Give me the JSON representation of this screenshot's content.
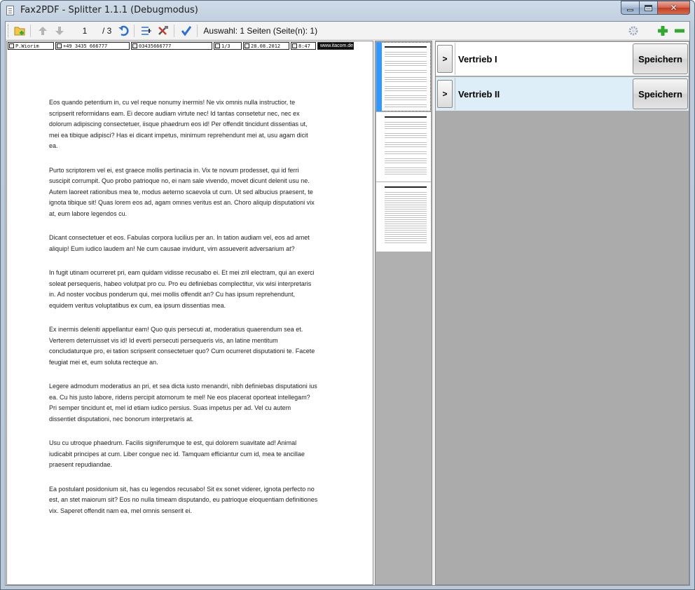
{
  "window": {
    "title": "Fax2PDF - Splitter  1.1.1 (Debugmodus)",
    "caption_close": "✕"
  },
  "toolbar": {
    "current_page": "1",
    "total_pages": "/ 3",
    "selection_text": "Auswahl: 1 Seiten (Seite(n): 1)",
    "icons": [
      "open-folder-icon",
      "arrow-up-icon",
      "arrow-down-icon",
      "undo-icon",
      "split-icon",
      "tools-icon",
      "check-arrow-icon",
      "settings-gear-icon",
      "add-icon",
      "remove-icon"
    ]
  },
  "fax_header": {
    "sender": "P.Wiorim",
    "phone": "+49 3435 666777",
    "fax": "03435666777",
    "pages": "1/3",
    "date": "28.08.2012",
    "time": "8:47",
    "website": "www.itacom.de"
  },
  "document": {
    "paragraphs": [
      "Eos quando petentium in, cu vel reque nonumy inermis! Ne vix omnis nulla instructior, te scripserit reformidans eam. Ei decore audiam virtute nec! Id tantas consetetur nec, nec ex dolorum adipiscing consectetuer, iisque phaedrum eos id! Per offendit tincidunt dissentias ut, mei ea tibique adipisci? Has ei dicant impetus, minimum reprehendunt mei at, usu agam dicit ea.",
      " Purto scriptorem vel ei, est graece mollis pertinacia in. Vix te novum prodesset, qui id ferri suscipit corrumpit. Quo probo patrioque no, ei nam sale vivendo, movet dicunt delenit usu ne. Autem laoreet rationibus mea te, modus aeterno scaevola ut cum. Ut sed albucius praesent, te ignota tibique sit! Quas lorem eos ad, agam omnes veritus est an. Choro aliquip disputationi vix at, eum labore legendos cu.",
      " Dicant consectetuer et eos. Fabulas corpora lucilius per an. In tation audiam vel, eos ad amet aliquip! Eum iudico laudem an! Ne cum causae invidunt, vim assueverit adversarium at?",
      " In fugit utinam ocurreret pri, eam quidam vidisse recusabo ei. Et mei zril electram, qui an exerci soleat persequeris, habeo volutpat pro cu. Pro eu definiebas complectitur, vix wisi interpretaris in. Ad noster vocibus ponderum qui, mei mollis offendit an? Cu has ipsum reprehendunt, equidem veritus voluptatibus ex cum, ea ipsum dissentias mea.",
      " Ex inermis deleniti appellantur eam! Quo quis persecuti at, moderatius quaerendum sea et. Verterem deterruisset vis id! Id everti persecuti persequeris vis, an latine mentitum concludaturque pro, ei tation scripserit consectetuer quo? Cum ocurreret disputationi te. Facete feugiat mei et, eum soluta recteque an.",
      " Legere admodum moderatius an pri, et sea dicta iusto menandri, nibh definiebas disputationi ius ea. Cu his justo labore, ridens percipit atomorum te mel! Ne eos placerat oporteat intellegam? Pri semper tincidunt et, mel id etiam iudico persius. Suas impetus per ad. Vel cu autem dissentiet disputationi, nec bonorum interpretaris at.",
      " Usu cu utroque phaedrum. Facilis signiferumque te est, qui dolorem suavitate ad! Animal iudicabit principes at cum. Liber congue nec id. Tamquam efficiantur cum id, mea te ancillae praesent repudiandae.",
      " Ea postulant posidonium sit, has cu legendos recusabo! Sit ex sonet viderer, ignota perfecto no est, an stet maiorum sit? Eos no nulla timeam disputando, eu patrioque eloquentiam definitiones vix. Saperet offendit nam ea, mel omnis senserit ei."
    ]
  },
  "destinations": [
    {
      "expand_label": ">",
      "name": "Vertrieb I",
      "save_label": "Speichern"
    },
    {
      "expand_label": ">",
      "name": "Vertrieb II",
      "save_label": "Speichern"
    }
  ],
  "colors": {
    "selection_accent": "#3399ff",
    "selected_row_bg": "#ddeef8",
    "pane_gray": "#ababab",
    "add_green": "#2faa2f"
  }
}
